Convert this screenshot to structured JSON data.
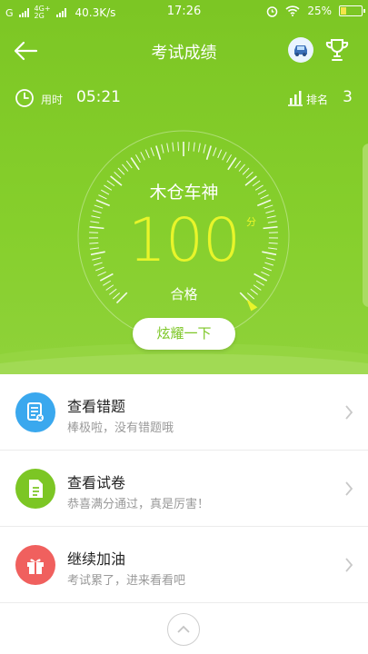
{
  "status_bar": {
    "carrier_1": "G",
    "net_top": "4G+",
    "net_bottom": "2G",
    "speed": "40.3K/s",
    "time": "17:26",
    "battery": "25%"
  },
  "nav": {
    "title": "考试成绩"
  },
  "info": {
    "time_label": "用时",
    "time_value": "05:21",
    "rank_label": "排名",
    "rank_value": "3"
  },
  "gauge": {
    "name": "木仓车神",
    "score": "100",
    "unit": "分",
    "result": "合格",
    "share_label": "炫耀一下"
  },
  "items": [
    {
      "title": "查看错题",
      "sub": "棒极啦，没有错题哦",
      "icon": "mistakes-doc-icon",
      "color": "#3aa8ee"
    },
    {
      "title": "查看试卷",
      "sub": "恭喜满分通过，真是厉害！",
      "icon": "paper-doc-icon",
      "color": "#7cc624"
    },
    {
      "title": "继续加油",
      "sub": "考试累了，进来看看吧",
      "icon": "gift-icon",
      "color": "#f0605e"
    }
  ],
  "colors": {
    "header_green": "#84cd2a",
    "score_yellow": "#e8f52a"
  }
}
